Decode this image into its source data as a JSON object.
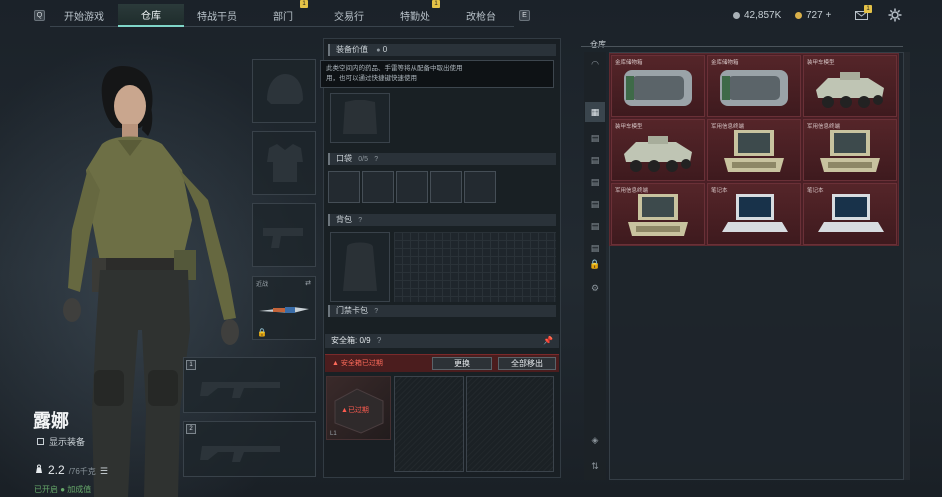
{
  "topbar": {
    "key_left": "Q",
    "key_right": "E",
    "tabs": [
      {
        "label": "开始游戏",
        "active": false,
        "badge": ""
      },
      {
        "label": "仓库",
        "active": true,
        "badge": ""
      },
      {
        "label": "特战干员",
        "active": false,
        "badge": ""
      },
      {
        "label": "部门",
        "active": false,
        "badge": "1"
      },
      {
        "label": "交易行",
        "active": false,
        "badge": ""
      },
      {
        "label": "特勤处",
        "active": false,
        "badge": "1"
      },
      {
        "label": "改枪台",
        "active": false,
        "badge": ""
      }
    ],
    "currency_silver": "42,857K",
    "currency_gold": "727 +",
    "mail_badge": "1"
  },
  "character": {
    "name": "露娜",
    "show_gear_label": "显示装备",
    "capacity_value": "2.2",
    "capacity_total": "/76千克",
    "bottom_hint": "已开启 ● 加成值"
  },
  "gear": {
    "melee_label": "近战",
    "slot1_num": "1",
    "slot2_num": "2"
  },
  "middle": {
    "equip_value_label": "装备价值",
    "equip_value": "0",
    "tooltip_line1": "此类空间内的药品、手雷等将从配备中取出使用",
    "tooltip_line2": "用，也可以通过快捷键快速使用",
    "pockets_label": "口袋",
    "pockets_value": "0/5",
    "backpack_label": "背包",
    "keycard_label": "门禁卡包",
    "safe_label": "安全箱: 0/9",
    "safe_alert": "安全箱已过期",
    "replace_btn": "更换",
    "remove_all_btn": "全部移出",
    "safe_expired_tag": "已过期",
    "safe_corner": "L1"
  },
  "warehouse": {
    "title": "仓库",
    "items": [
      {
        "label": "金库储物箱",
        "kind": "container"
      },
      {
        "label": "金库储物箱",
        "kind": "container"
      },
      {
        "label": "装甲车模型",
        "kind": "vehicle"
      },
      {
        "label": "装甲车模型",
        "kind": "vehicle"
      },
      {
        "label": "军用信息终端",
        "kind": "terminal"
      },
      {
        "label": "军用信息终端",
        "kind": "terminal"
      },
      {
        "label": "军用信息终端",
        "kind": "terminal"
      },
      {
        "label": "笔记本",
        "kind": "laptop"
      },
      {
        "label": "笔记本",
        "kind": "laptop"
      }
    ]
  }
}
